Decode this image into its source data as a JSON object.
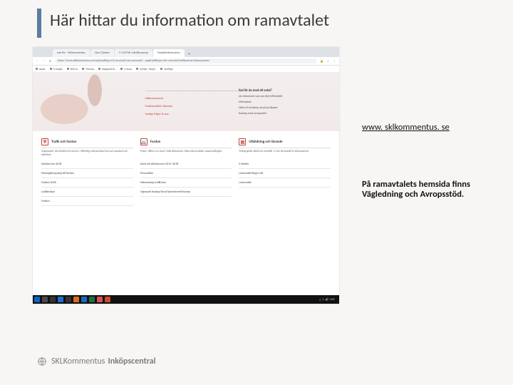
{
  "title": "Här hittar du information om ramavtalet",
  "side_link": {
    "text": "www. sklkommentus. se",
    "href": "http://www.sklkommentus.se"
  },
  "side_desc": "På ramavtalets hemsida finns Vägledning och Avropsstöd.",
  "footer": {
    "brand_a": "SKLKommentus",
    "brand_b": "Inköpscentral"
  },
  "screenshot": {
    "tabs": [
      {
        "label": "Inte för - SKLkommentus",
        "active": false
      },
      {
        "label": "Våra Tjänster",
        "active": false
      },
      {
        "label": "FI 109726 i vård&omsorg",
        "active": false
      },
      {
        "label": "Produktinformation",
        "active": true
      }
    ],
    "address": "https://www.sklkommentus.se/upphandling-och-ramavtal/vara-ramavtal/...upphandlingar-och-ramavtal/webbaserat-inkopssystem/",
    "address_right_icons": [
      "lock",
      "star",
      "menu"
    ],
    "bookmarks": [
      "Appar",
      "G Google",
      "SKLk.se",
      "Primona",
      "begagnad bi...",
      "e-avrop",
      "Sverige - Kungl...",
      "tendSign"
    ],
    "hero": {
      "mid_items": [
        "Inköpssystemen",
        "Funktionalitet i tjänsten",
        "Vanliga frågor & svar"
      ],
      "right_headline": "Vad får du med ett avtal?",
      "right_lines": [
        "Läs dokument som ger dig helhetsbild",
        "Mötesplats",
        "Stöd och kunskap att gå på djupet",
        "Katalog med avropsstöd"
      ]
    },
    "columns": [
      {
        "icon": "shield",
        "title": "Trafik och fordon",
        "sub": "Vagnparker, drivmedel och service. Offentlig verksamhets krav på standard och säkerhet.",
        "items": [
          "Däckservice 2018",
          "Elenergibesparing till fordon",
          "Fordon 2018",
          "Laddstolpar",
          "Fordon"
        ]
      },
      {
        "icon": "van",
        "title": "Fordon",
        "sub": "Priser, villkor och avtal i fulla dokument. Hitta rätt produkt i upphandlingen.",
        "items": [
          "Däck och däckservice 2014–2018",
          "Personbilar",
          "Yrkesmässig trafik/taxi",
          "Vagnpark leasing/hyra/Operationell leasing"
        ]
      },
      {
        "icon": "book",
        "title": "Utbildning och lärande",
        "sub": "Pedagogiskt utfall och innehåll. Vi har läromedel & skolmaterial.",
        "items": [
          "E-böcker",
          "Läromedel längre tid",
          "Läromedel"
        ]
      }
    ]
  }
}
